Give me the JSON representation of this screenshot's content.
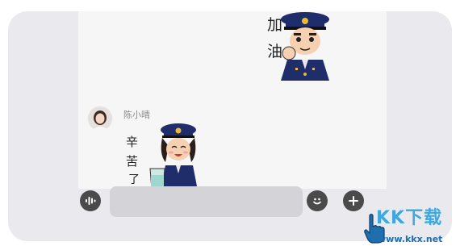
{
  "chat": {
    "message1": {
      "sticker_lines": [
        "加",
        "油"
      ]
    },
    "message2": {
      "sender_name": "陈小晴",
      "sticker_lines": [
        "辛",
        "苦",
        "了"
      ]
    }
  },
  "input_bar": {
    "text_value": "",
    "icons": [
      "voice-icon",
      "emoji-icon",
      "plus-icon"
    ]
  },
  "watermark": {
    "brand_text": "KK下载",
    "url": "www.kkx.net"
  },
  "colors": {
    "background": "#e9e9ee",
    "chat_background": "#f6f6f6",
    "input_field": "#d4d4d8",
    "icon": "#4a4a4a",
    "uniform_blue": "#1f2d6b",
    "watermark_blue": "#2aa1e0"
  }
}
